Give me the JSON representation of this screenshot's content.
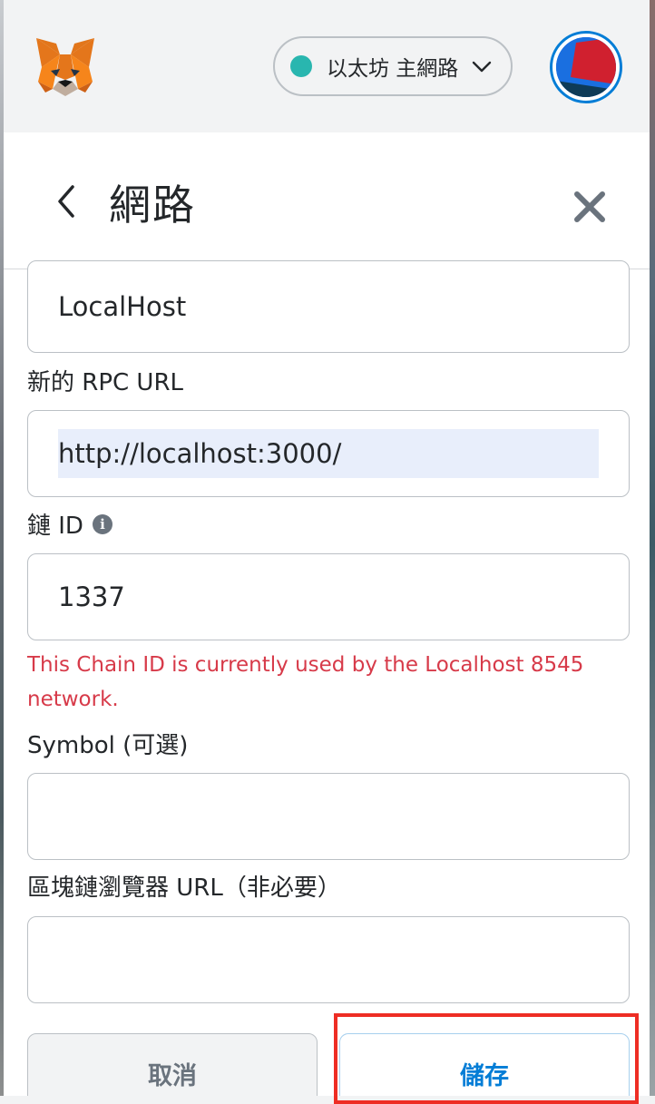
{
  "header": {
    "network": {
      "label": "以太坊 主網路",
      "dot_color": "#29b6af"
    },
    "avatar_colors": [
      "#1a6fe0",
      "#d0202f",
      "#0e3b57"
    ]
  },
  "subheader": {
    "title": "網路"
  },
  "form": {
    "network_name_value": "LocalHost",
    "rpc_url_label": "新的 RPC URL",
    "rpc_url_value": "http://localhost:3000/",
    "chain_id_label": "鏈 ID",
    "chain_id_info_icon": "i",
    "chain_id_value": "1337",
    "chain_id_error": "This Chain ID is currently used by the Localhost 8545 network.",
    "symbol_label": "Symbol (可選)",
    "symbol_value": "",
    "explorer_label": "區塊鏈瀏覽器 URL（非必要）",
    "explorer_value": ""
  },
  "buttons": {
    "cancel": "取消",
    "save": "儲存"
  },
  "colors": {
    "accent": "#037dd6",
    "error": "#d73a49",
    "highlight": "#ee2d24"
  }
}
